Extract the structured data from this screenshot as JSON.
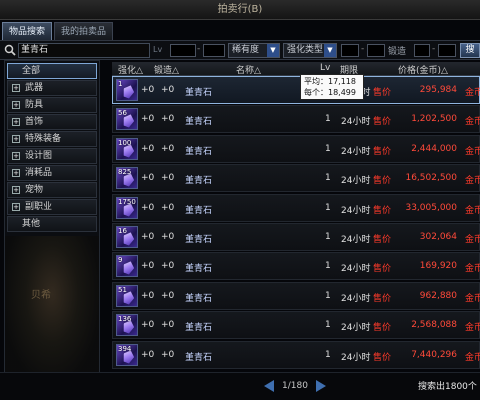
{
  "window": {
    "title": "拍卖行(B)"
  },
  "tabs": [
    {
      "label": "物品搜索",
      "active": true
    },
    {
      "label": "我的拍卖品",
      "active": false
    }
  ],
  "search": {
    "query": "堇青石",
    "lv_label": "Lv",
    "rarity_dropdown": "稀有度",
    "enhance_dropdown": "强化类型",
    "forge_label": "锻造",
    "search_button": "搜"
  },
  "sidebar": {
    "categories": [
      {
        "label": "全部",
        "expandable": false,
        "selected": true
      },
      {
        "label": "武器",
        "expandable": true
      },
      {
        "label": "防具",
        "expandable": true
      },
      {
        "label": "首饰",
        "expandable": true
      },
      {
        "label": "特殊装备",
        "expandable": true
      },
      {
        "label": "设计图",
        "expandable": true
      },
      {
        "label": "消耗品",
        "expandable": true
      },
      {
        "label": "宠物",
        "expandable": true
      },
      {
        "label": "副职业",
        "expandable": true
      },
      {
        "label": "其他",
        "expandable": false
      }
    ],
    "background_text": "贝希"
  },
  "table": {
    "headers": {
      "enhance": "强化△",
      "forge": "锻造△",
      "name": "名称△",
      "level": "Lv",
      "time": "期限",
      "price": "价格(金币)△"
    },
    "rows": [
      {
        "count": "1",
        "enhance": "+0",
        "forge": "+0",
        "name": "堇青石",
        "level": "1",
        "time": "24小时",
        "status": "售价",
        "price": "295,984",
        "currency": "金币",
        "selected": true
      },
      {
        "count": "56",
        "enhance": "+0",
        "forge": "+0",
        "name": "堇青石",
        "level": "1",
        "time": "24小时",
        "status": "售价",
        "price": "1,202,500",
        "currency": "金币"
      },
      {
        "count": "100",
        "enhance": "+0",
        "forge": "+0",
        "name": "堇青石",
        "level": "1",
        "time": "24小时",
        "status": "售价",
        "price": "2,444,000",
        "currency": "金币"
      },
      {
        "count": "825",
        "enhance": "+0",
        "forge": "+0",
        "name": "堇青石",
        "level": "1",
        "time": "24小时",
        "status": "售价",
        "price": "16,502,500",
        "currency": "金币"
      },
      {
        "count": "1750",
        "enhance": "+0",
        "forge": "+0",
        "name": "堇青石",
        "level": "1",
        "time": "24小时",
        "status": "售价",
        "price": "33,005,000",
        "currency": "金币"
      },
      {
        "count": "16",
        "enhance": "+0",
        "forge": "+0",
        "name": "堇青石",
        "level": "1",
        "time": "24小时",
        "status": "售价",
        "price": "302,064",
        "currency": "金币"
      },
      {
        "count": "9",
        "enhance": "+0",
        "forge": "+0",
        "name": "堇青石",
        "level": "1",
        "time": "24小时",
        "status": "售价",
        "price": "169,920",
        "currency": "金币"
      },
      {
        "count": "51",
        "enhance": "+0",
        "forge": "+0",
        "name": "堇青石",
        "level": "1",
        "time": "24小时",
        "status": "售价",
        "price": "962,880",
        "currency": "金币"
      },
      {
        "count": "136",
        "enhance": "+0",
        "forge": "+0",
        "name": "堇青石",
        "level": "1",
        "time": "24小时",
        "status": "售价",
        "price": "2,568,088",
        "currency": "金币"
      },
      {
        "count": "394",
        "enhance": "+0",
        "forge": "+0",
        "name": "堇青石",
        "level": "1",
        "time": "24小时",
        "status": "售价",
        "price": "7,440,296",
        "currency": "金币"
      }
    ]
  },
  "tooltip": {
    "line1": "平均：17,118",
    "line2": "每个：18,499"
  },
  "pagination": {
    "page_text": "1/180"
  },
  "footer": {
    "result_count": "搜索出1800个"
  },
  "colors": {
    "price_red": "#ff4a3a",
    "accent_blue": "#3f6fb0",
    "selection_border": "#8fb4df"
  }
}
